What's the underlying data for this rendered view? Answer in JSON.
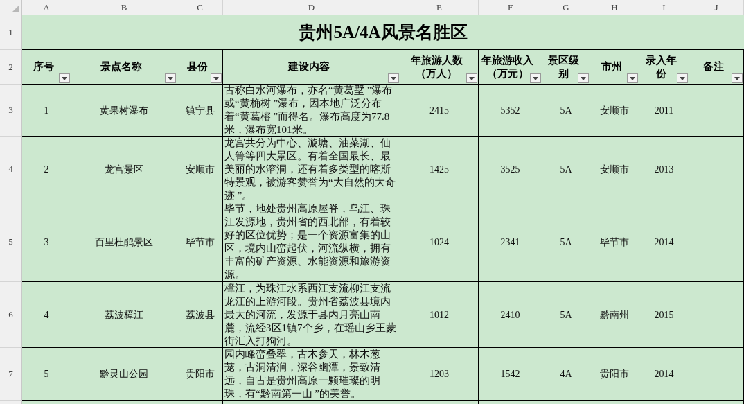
{
  "column_letters": [
    "A",
    "B",
    "C",
    "D",
    "E",
    "F",
    "G",
    "H",
    "I",
    "J"
  ],
  "title": {
    "row_number": "1",
    "text": "贵州5A/4A风景名胜区"
  },
  "header": {
    "row_number": "2",
    "columns": [
      {
        "label": "序号"
      },
      {
        "label": "景点名称"
      },
      {
        "label": "县份"
      },
      {
        "label": "建设内容"
      },
      {
        "label": "年旅游人数（万人）"
      },
      {
        "label": "年旅游收入（万元）"
      },
      {
        "label": "景区级别"
      },
      {
        "label": "市州"
      },
      {
        "label": "录入年份"
      },
      {
        "label": "备注"
      }
    ]
  },
  "rows": [
    {
      "row_number": "3",
      "values": [
        "1",
        "黄果树瀑布",
        "镇宁县",
        "古称白水河瀑布，亦名“黄葛墅 ”瀑布或“黄桷树 ”瀑布，因本地广泛分布着“黄葛榕 ”而得名。瀑布高度为77.8米，瀑布宽101米。",
        "2415",
        "5352",
        "5A",
        "安顺市",
        "2011"
      ]
    },
    {
      "row_number": "4",
      "values": [
        "2",
        "龙宫景区",
        "安顺市",
        " 龙宫共分为中心、漩塘、油菜湖、仙人箐等四大景区。有着全国最长、最美丽的水溶洞，还有着多类型的喀斯特景观，被游客赞誉为“大自然的大奇迹 ”。",
        "1425",
        "3525",
        "5A",
        "安顺市",
        "2013"
      ]
    },
    {
      "row_number": "5",
      "values": [
        "3",
        "百里杜鹃景区",
        "毕节市",
        "毕节，地处贵州高原屋脊，乌江、珠江发源地，贵州省的西北部，有着较好的区位优势；是一个资源富集的山区，境内山峦起伏，河流纵横，拥有丰富的矿产资源、水能资源和旅游资源。",
        "1024",
        "2341",
        "5A",
        "毕节市",
        "2014"
      ]
    },
    {
      "row_number": "6",
      "values": [
        "4",
        "荔波樟江",
        "荔波县",
        "樟江，为珠江水系西江支流柳江支流龙江的上游河段。贵州省荔波县境内最大的河流，发源于县内月亮山南麓，流经3区1镇7个乡，在瑶山乡王蒙街汇入打狗河。",
        "1012",
        "2410",
        "5A",
        "黔南州",
        "2015"
      ]
    },
    {
      "row_number": "7",
      "values": [
        "5",
        "黔灵山公园",
        "贵阳市",
        "园内峰峦叠翠，古木参天，林木葱茏，古洞清涧，深谷幽潭，景致清远，自古是贵州高原一颗璀璨的明珠，有“黔南第一山 ”的美誉。",
        "1203",
        "1542",
        "4A",
        "贵阳市",
        "2014"
      ]
    }
  ]
}
